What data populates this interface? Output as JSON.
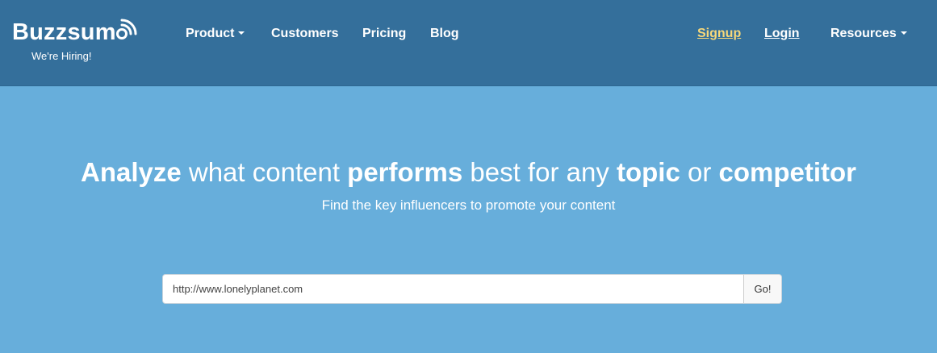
{
  "header": {
    "logo_text": "Buzzsum",
    "logo_icon": "broadcast-o-icon",
    "hiring": "We're Hiring!",
    "nav": {
      "product": "Product",
      "customers": "Customers",
      "pricing": "Pricing",
      "blog": "Blog",
      "signup": "Signup",
      "login": "Login",
      "resources": "Resources"
    }
  },
  "hero": {
    "headline": {
      "w1": "Analyze",
      "t1": " what content ",
      "w2": "performs",
      "t2": " best for any ",
      "w3": "topic",
      "t3": " or ",
      "w4": "competitor"
    },
    "subline": "Find the key influencers to promote your content"
  },
  "search": {
    "value": "http://www.lonelyplanet.com",
    "button_label": "Go!"
  },
  "colors": {
    "header_bg": "#346f9b",
    "hero_bg": "#67aedb",
    "signup": "#f7d87a"
  }
}
